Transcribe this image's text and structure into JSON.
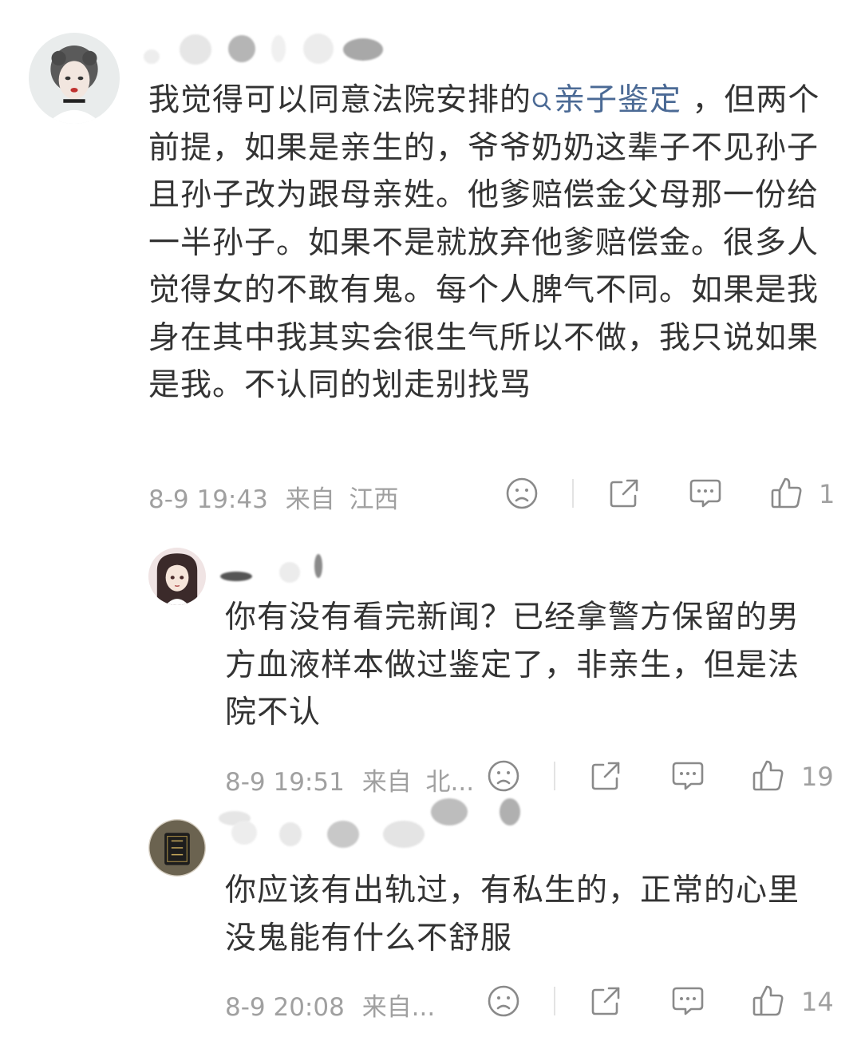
{
  "comments": [
    {
      "avatar": "user-avatar-girl",
      "text_before": "我觉得可以同意法院安排的",
      "topic": "亲子鉴定",
      "text_after": " ，但两个前提，如果是亲生的，爷爷奶奶这辈子不见孙子且孙子改为跟母亲姓。他爹赔偿金父母那一份给一半孙子。如果不是就放弃他爹赔偿金。很多人觉得女的不敢有鬼。每个人脾气不同。如果是我身在其中我其实会很生气所以不做，我只说如果是我。不认同的划走别找骂",
      "time": "8-9 19:43",
      "from_label": "来自",
      "location": "江西",
      "likes": "1"
    },
    {
      "avatar": "user-avatar-anime",
      "text": "你有没有看完新闻？已经拿警方保留的男方血液样本做过鉴定了，非亲生，但是法院不认",
      "time": "8-9 19:51",
      "from_label": "来自",
      "location": "北...",
      "likes": "19"
    },
    {
      "avatar": "user-avatar-dark",
      "text": "你应该有出轨过，有私生的，正常的心里没鬼能有什么不舒服",
      "time": "8-9 20:08",
      "from_label": "来自...",
      "location": "",
      "likes": "14"
    }
  ],
  "icons": [
    "sad-face-icon",
    "share-icon",
    "comment-icon",
    "like-icon",
    "search-icon"
  ],
  "colors": {
    "topic": "#4b6a95",
    "meta": "#a0a0a0",
    "text": "#333333"
  }
}
